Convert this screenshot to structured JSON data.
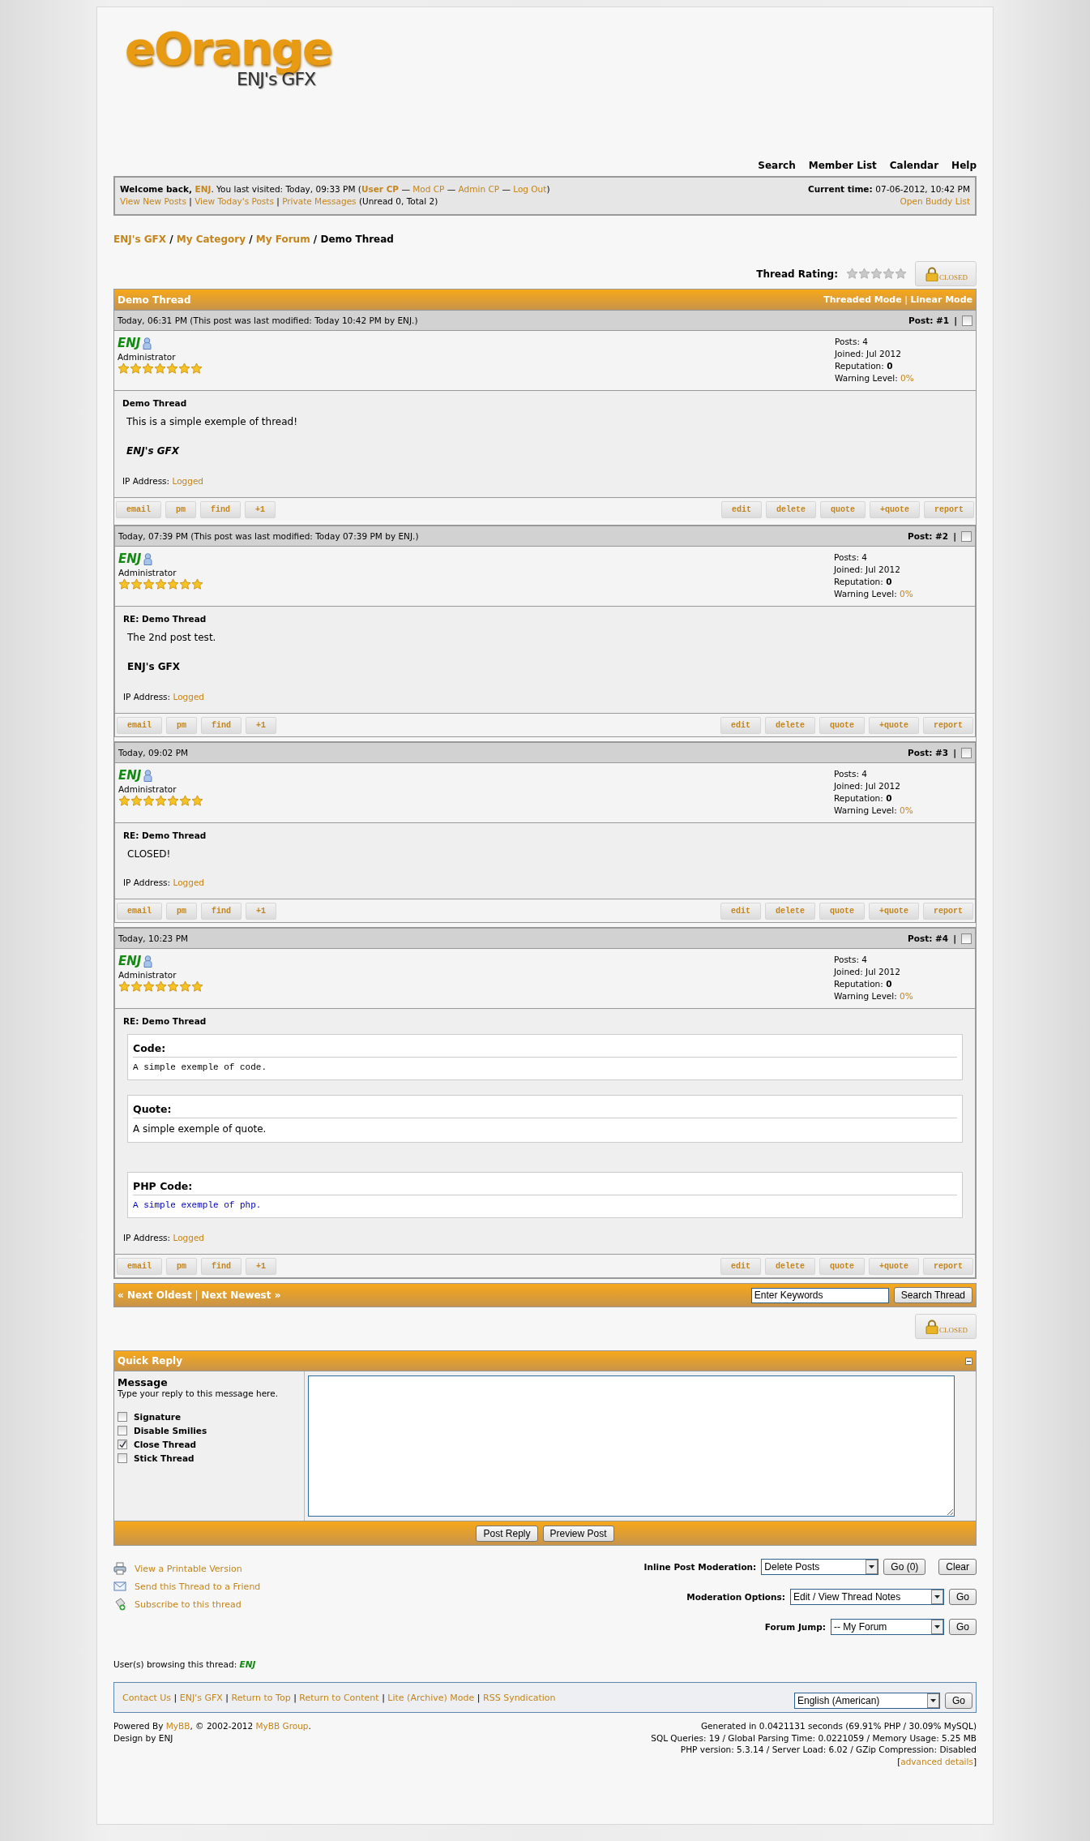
{
  "logo": {
    "title": "eOrange",
    "subtitle": "ENJ's GFX"
  },
  "top_nav": [
    "Search",
    "Member List",
    "Calendar",
    "Help"
  ],
  "welcome": {
    "line_1": [
      {
        "text": "Welcome back, ",
        "kind": "bold"
      },
      {
        "text": "ENJ",
        "kind": "bold_link"
      },
      {
        "text": ". You last visited: Today, 09:33 PM (",
        "kind": "text"
      },
      {
        "text": "User CP",
        "kind": "bold_link"
      },
      {
        "text": " — ",
        "kind": "text"
      },
      {
        "text": "Mod CP",
        "kind": "link"
      },
      {
        "text": " — ",
        "kind": "text"
      },
      {
        "text": "Admin CP",
        "kind": "link"
      },
      {
        "text": " — ",
        "kind": "text"
      },
      {
        "text": "Log Out",
        "kind": "link"
      },
      {
        "text": ")",
        "kind": "text"
      }
    ],
    "line_2": [
      {
        "text": "View New Posts",
        "kind": "link"
      },
      {
        "text": " | ",
        "kind": "text"
      },
      {
        "text": "View Today's Posts",
        "kind": "link"
      },
      {
        "text": " | ",
        "kind": "text"
      },
      {
        "text": "Private Messages",
        "kind": "link"
      },
      {
        "text": " (Unread 0, Total 2)",
        "kind": "text"
      }
    ],
    "current_time": [
      {
        "text": "Current time: ",
        "kind": "bold"
      },
      {
        "text": "07-06-2012, 10:42 PM",
        "kind": "text"
      }
    ],
    "buddy_link": "Open Buddy List"
  },
  "breadcrumb": [
    {
      "text": "ENJ's GFX",
      "kind": "link"
    },
    {
      "text": " / ",
      "kind": "text"
    },
    {
      "text": "My Category",
      "kind": "link"
    },
    {
      "text": " / ",
      "kind": "text"
    },
    {
      "text": "My Forum",
      "kind": "link"
    },
    {
      "text": " / ",
      "kind": "text"
    },
    {
      "text": "Demo Thread",
      "kind": "bold"
    }
  ],
  "thread_rating": {
    "label": "Thread Rating:",
    "stars": 0,
    "closed_button": "CLOSED"
  },
  "thread": {
    "title": "Demo Thread",
    "modes": [
      {
        "text": "Threaded Mode",
        "kind": "link"
      },
      {
        "text": " | ",
        "kind": "text"
      },
      {
        "text": "Linear Mode",
        "kind": "link"
      }
    ],
    "posts": [
      {
        "date": "Today, 06:31 PM (This post was last modified: Today 10:42 PM by ENJ.)",
        "number": "Post: #1",
        "separator": "|",
        "checked": false,
        "author": "ENJ",
        "user_title": "Administrator",
        "stars": 7,
        "stats": [
          {
            "label": "Posts: ",
            "value": "4",
            "kind": "plain"
          },
          {
            "label": "Joined: ",
            "value": "Jul 2012",
            "kind": "plain"
          },
          {
            "label": "Reputation: ",
            "value": "0",
            "kind": "bold"
          },
          {
            "label": "Warning Level: ",
            "value": "0%",
            "kind": "link"
          }
        ],
        "subject": "Demo Thread",
        "blocks": [
          {
            "kind": "text",
            "text": "This is a simple exemple of thread!"
          },
          {
            "kind": "signature",
            "text": "ENJ's GFX",
            "italic": true
          }
        ],
        "ip_label": "IP Address: ",
        "ip_value": "Logged",
        "left_buttons": [
          "email",
          "pm",
          "find",
          "+1"
        ],
        "right_buttons": [
          "edit",
          "delete",
          "quote",
          "+quote",
          "report"
        ]
      },
      {
        "date": "Today, 07:39 PM (This post was last modified: Today 07:39 PM by ENJ.)",
        "number": "Post: #2",
        "separator": "|",
        "checked": false,
        "author": "ENJ",
        "user_title": "Administrator",
        "stars": 7,
        "stats": [
          {
            "label": "Posts: ",
            "value": "4",
            "kind": "plain"
          },
          {
            "label": "Joined: ",
            "value": "Jul 2012",
            "kind": "plain"
          },
          {
            "label": "Reputation: ",
            "value": "0",
            "kind": "bold"
          },
          {
            "label": "Warning Level: ",
            "value": "0%",
            "kind": "link"
          }
        ],
        "subject": "RE: Demo Thread",
        "blocks": [
          {
            "kind": "text",
            "text": "The 2nd post test."
          },
          {
            "kind": "signature",
            "text": "ENJ's GFX",
            "italic": false
          }
        ],
        "ip_label": "IP Address: ",
        "ip_value": "Logged",
        "left_buttons": [
          "email",
          "pm",
          "find",
          "+1"
        ],
        "right_buttons": [
          "edit",
          "delete",
          "quote",
          "+quote",
          "report"
        ]
      },
      {
        "date": "Today, 09:02 PM",
        "number": "Post: #3",
        "separator": "|",
        "checked": false,
        "author": "ENJ",
        "user_title": "Administrator",
        "stars": 7,
        "stats": [
          {
            "label": "Posts: ",
            "value": "4",
            "kind": "plain"
          },
          {
            "label": "Joined: ",
            "value": "Jul 2012",
            "kind": "plain"
          },
          {
            "label": "Reputation: ",
            "value": "0",
            "kind": "bold"
          },
          {
            "label": "Warning Level: ",
            "value": "0%",
            "kind": "link"
          }
        ],
        "subject": "RE: Demo Thread",
        "blocks": [
          {
            "kind": "text",
            "text": "CLOSED!"
          }
        ],
        "ip_label": "IP Address: ",
        "ip_value": "Logged",
        "left_buttons": [
          "email",
          "pm",
          "find",
          "+1"
        ],
        "right_buttons": [
          "edit",
          "delete",
          "quote",
          "+quote",
          "report"
        ]
      },
      {
        "date": "Today, 10:23 PM",
        "number": "Post: #4",
        "separator": "|",
        "checked": false,
        "author": "ENJ",
        "user_title": "Administrator",
        "stars": 7,
        "stats": [
          {
            "label": "Posts: ",
            "value": "4",
            "kind": "plain"
          },
          {
            "label": "Joined: ",
            "value": "Jul 2012",
            "kind": "plain"
          },
          {
            "label": "Reputation: ",
            "value": "0",
            "kind": "bold"
          },
          {
            "label": "Warning Level: ",
            "value": "0%",
            "kind": "link"
          }
        ],
        "subject": "RE: Demo Thread",
        "blocks": [
          {
            "kind": "code",
            "title": "Code:",
            "text": "A simple exemple of code."
          },
          {
            "kind": "quote",
            "title": "Quote:",
            "text": "A simple exemple of quote."
          },
          {
            "kind": "php",
            "title": "PHP Code:",
            "text": "A simple exemple of php."
          }
        ],
        "ip_label": "IP Address: ",
        "ip_value": "Logged",
        "left_buttons": [
          "email",
          "pm",
          "find",
          "+1"
        ],
        "right_buttons": [
          "edit",
          "delete",
          "quote",
          "+quote",
          "report"
        ]
      }
    ],
    "navigation": [
      {
        "text": "« Next Oldest",
        "kind": "link"
      },
      {
        "text": " | ",
        "kind": "text"
      },
      {
        "text": "Next Newest »",
        "kind": "link"
      }
    ],
    "search_value": "Enter Keywords",
    "search_button": "Search Thread",
    "closed_button": "CLOSED"
  },
  "quick_reply": {
    "title": "Quick Reply",
    "message_label": "Message",
    "message_hint": "Type your reply to this message here.",
    "options": [
      {
        "label": "Signature",
        "checked": false
      },
      {
        "label": "Disable Smilies",
        "checked": false
      },
      {
        "label": "Close Thread",
        "checked": true
      },
      {
        "label": "Stick Thread",
        "checked": false
      }
    ],
    "buttons": [
      "Post Reply",
      "Preview Post"
    ]
  },
  "tools": [
    {
      "kind": "printer",
      "label": "View a Printable Version"
    },
    {
      "kind": "envelope",
      "label": "Send this Thread to a Friend"
    },
    {
      "kind": "subscribe",
      "label": "Subscribe to this thread"
    }
  ],
  "moderation": [
    {
      "label": "Inline Post Moderation:",
      "select": "Delete Posts",
      "buttons": [
        "Go (0)",
        "Clear"
      ]
    },
    {
      "label": "Moderation Options:",
      "select": "Edit / View Thread Notes",
      "buttons": [
        "Go"
      ]
    },
    {
      "label": "Forum Jump:",
      "select": "-- My Forum",
      "buttons": [
        "Go"
      ]
    }
  ],
  "browsing": {
    "label": "User(s) browsing this thread: ",
    "user": "ENJ"
  },
  "footer": {
    "links": [
      {
        "text": "Contact Us",
        "kind": "link"
      },
      {
        "text": " | ",
        "kind": "text"
      },
      {
        "text": "ENJ's GFX",
        "kind": "link"
      },
      {
        "text": " | ",
        "kind": "text"
      },
      {
        "text": "Return to Top",
        "kind": "link"
      },
      {
        "text": " | ",
        "kind": "text"
      },
      {
        "text": "Return to Content",
        "kind": "link"
      },
      {
        "text": " | ",
        "kind": "text"
      },
      {
        "text": "Lite (Archive) Mode",
        "kind": "link"
      },
      {
        "text": " | ",
        "kind": "text"
      },
      {
        "text": "RSS Syndication",
        "kind": "link"
      }
    ],
    "language": "English (American)",
    "language_button": "Go"
  },
  "copyright": {
    "left": [
      [
        {
          "text": "Powered By ",
          "kind": "text"
        },
        {
          "text": "MyBB",
          "kind": "link"
        },
        {
          "text": ", © 2002-2012 ",
          "kind": "text"
        },
        {
          "text": "MyBB Group",
          "kind": "link"
        },
        {
          "text": ".",
          "kind": "text"
        }
      ],
      [
        {
          "text": "Design by ENJ",
          "kind": "text"
        }
      ]
    ],
    "right": [
      [
        {
          "text": "Generated in 0.0421131 seconds (69.91% PHP / 30.09% MySQL)",
          "kind": "text"
        }
      ],
      [
        {
          "text": "SQL Queries: 19 / Global Parsing Time: 0.0221059 / Memory Usage: 5.25 MB",
          "kind": "text"
        }
      ],
      [
        {
          "text": "PHP version: 5.3.14 / Server Load: 6.02 / GZip Compression: Disabled",
          "kind": "text"
        }
      ],
      [
        {
          "text": "[",
          "kind": "text"
        },
        {
          "text": "advanced details",
          "kind": "link"
        },
        {
          "text": "]",
          "kind": "text"
        }
      ]
    ]
  }
}
